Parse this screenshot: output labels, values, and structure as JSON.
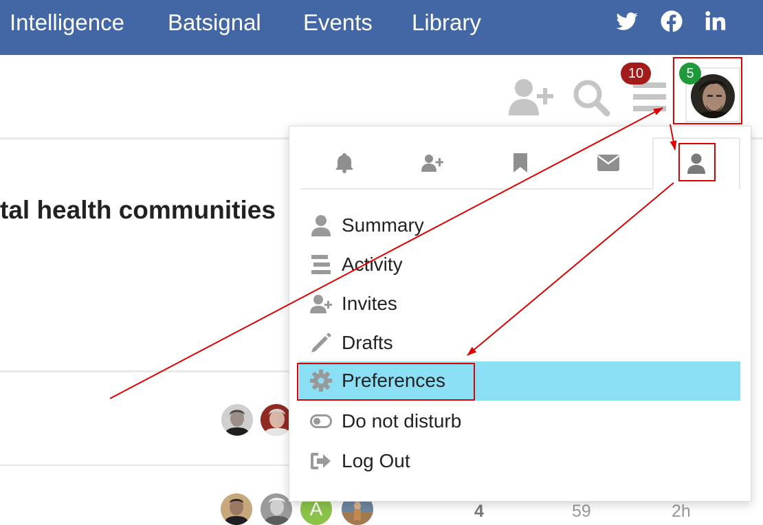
{
  "topnav": {
    "links": [
      "Intelligence",
      "Batsignal",
      "Events",
      "Library"
    ],
    "social": [
      "twitter-icon",
      "facebook-icon",
      "linkedin-icon"
    ],
    "bg_color": "#4367a5"
  },
  "header": {
    "notification_count": "10",
    "user_badge_count": "5",
    "icons": [
      "add-user-icon",
      "search-icon",
      "hamburger-menu-icon",
      "user-avatar"
    ]
  },
  "topic": {
    "title_fragment": "tal health communities"
  },
  "topic_rows": [
    {
      "stats": []
    },
    {
      "avatar_letter": "A",
      "stats": [
        "4",
        "59",
        "2h"
      ]
    }
  ],
  "user_menu": {
    "tabs": [
      "bell-icon",
      "user-plus-icon",
      "bookmark-icon",
      "envelope-icon",
      "user-icon"
    ],
    "active_tab": "user-icon",
    "items": [
      {
        "label": "Summary",
        "icon": "user-icon"
      },
      {
        "label": "Activity",
        "icon": "stream-icon"
      },
      {
        "label": "Invites",
        "icon": "user-plus-icon"
      },
      {
        "label": "Drafts",
        "icon": "pencil-icon"
      },
      {
        "label": "Preferences",
        "icon": "gear-icon"
      },
      {
        "label": "Do not disturb",
        "icon": "toggle-icon"
      },
      {
        "label": "Log Out",
        "icon": "sign-out-icon"
      }
    ],
    "highlighted_item": "Preferences",
    "highlight_color": "#8adff4"
  },
  "annotation_color": "#e00000"
}
